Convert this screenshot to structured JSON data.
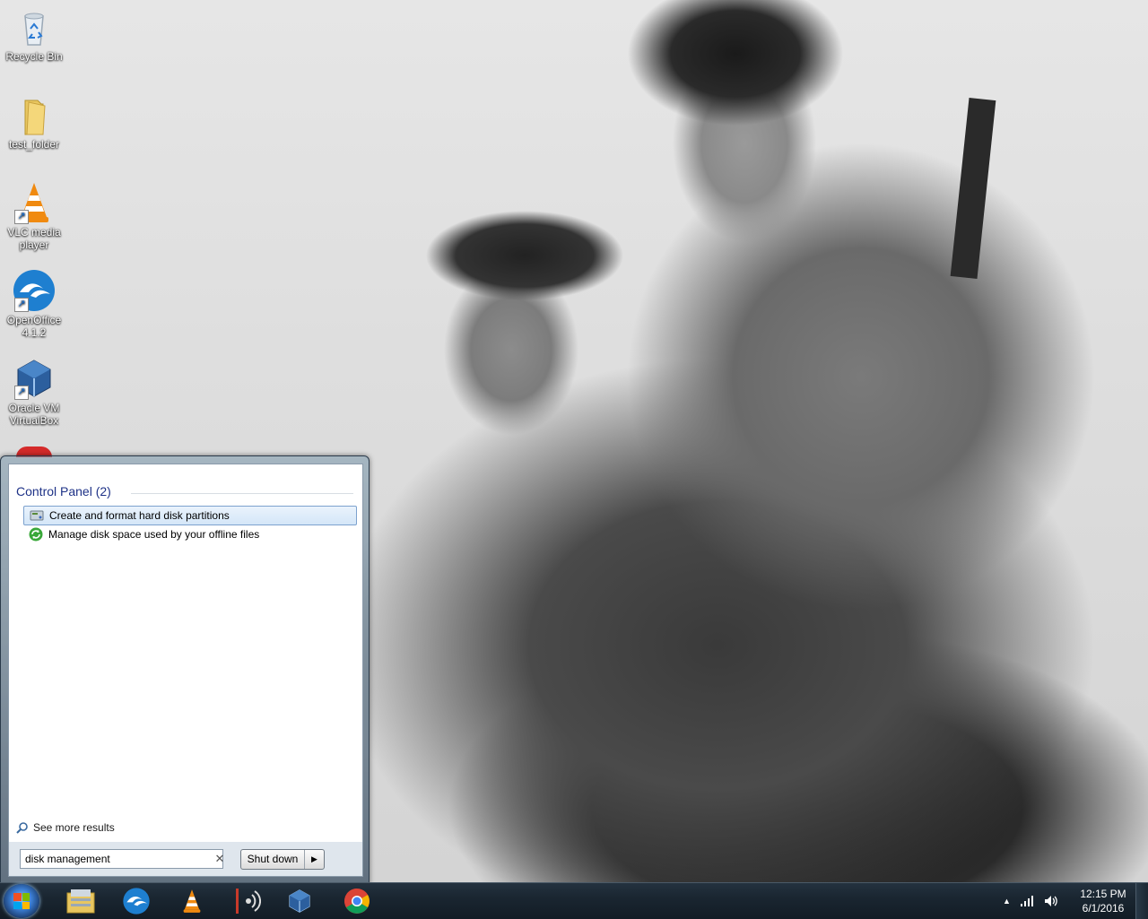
{
  "desktop": {
    "icons": [
      {
        "label": "Recycle Bin",
        "icon": "recycle-bin-icon"
      },
      {
        "label": "test_folder",
        "icon": "folder-icon"
      },
      {
        "label": "VLC media player",
        "icon": "vlc-icon"
      },
      {
        "label": "OpenOffice 4.1.2",
        "icon": "openoffice-icon"
      },
      {
        "label": "Oracle VM VirtualBox",
        "icon": "virtualbox-icon"
      }
    ]
  },
  "start_menu": {
    "category_heading": "Control Panel (2)",
    "results": [
      {
        "label": "Create and format hard disk partitions",
        "icon": "disk-management-icon",
        "selected": true
      },
      {
        "label": "Manage disk space used by your offline files",
        "icon": "sync-center-icon",
        "selected": false
      }
    ],
    "see_more": "See more results",
    "search_value": "disk management",
    "shutdown_label": "Shut down"
  },
  "taskbar": {
    "pinned": [
      "windows-explorer-icon",
      "openoffice-icon",
      "vlc-icon",
      "audio-app-icon",
      "virtualbox-icon",
      "chrome-icon"
    ],
    "time": "12:15 PM",
    "date": "6/1/2016"
  },
  "colors": {
    "heading_blue": "#1e3287",
    "selection_border": "#7da2ce",
    "taskbar": "#1a2631"
  }
}
